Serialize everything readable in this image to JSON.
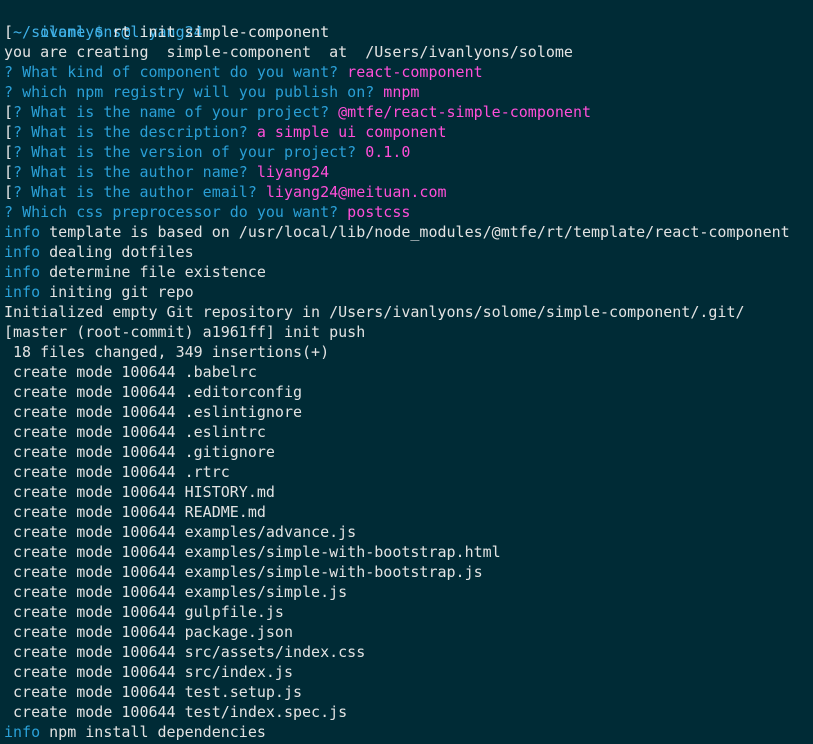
{
  "session": {
    "user_host": "ivanlyons@liyang24",
    "cwd": "~/solome",
    "prompt_symbol": "$",
    "command": "rt init simple-component"
  },
  "creating_line": "you are creating  simple-component  at  /Users/ivanlyons/solome",
  "questions": [
    {
      "prefix": "?",
      "question": "What kind of component do you want?",
      "answer": "react-component",
      "bracket": false
    },
    {
      "prefix": "?",
      "question": "which npm registry will you publish on?",
      "answer": "mnpm",
      "bracket": false
    },
    {
      "prefix": "?",
      "question": "What is the name of your project?",
      "answer": "@mtfe/react-simple-component",
      "bracket": true
    },
    {
      "prefix": "?",
      "question": "What is the description?",
      "answer": "a simple ui component",
      "bracket": true
    },
    {
      "prefix": "?",
      "question": "What is the version of your project?",
      "answer": "0.1.0",
      "bracket": true
    },
    {
      "prefix": "?",
      "question": "What is the author name?",
      "answer": "liyang24",
      "bracket": true
    },
    {
      "prefix": "?",
      "question": "What is the author email?",
      "answer": "liyang24@meituan.com",
      "bracket": true
    },
    {
      "prefix": "?",
      "question": "Which css preprocessor do you want?",
      "answer": "postcss",
      "bracket": false
    }
  ],
  "info_lines": [
    {
      "tag": "info",
      "text": "template is based on /usr/local/lib/node_modules/@mtfe/rt/template/react-component"
    },
    {
      "tag": "info",
      "text": "dealing dotfiles"
    },
    {
      "tag": "info",
      "text": "determine file existence"
    },
    {
      "tag": "info",
      "text": "initing git repo"
    }
  ],
  "git_output": [
    "Initialized empty Git repository in /Users/ivanlyons/solome/simple-component/.git/",
    "[master (root-commit) a1961ff] init push",
    " 18 files changed, 349 insertions(+)"
  ],
  "created_files": [
    " create mode 100644 .babelrc",
    " create mode 100644 .editorconfig",
    " create mode 100644 .eslintignore",
    " create mode 100644 .eslintrc",
    " create mode 100644 .gitignore",
    " create mode 100644 .rtrc",
    " create mode 100644 HISTORY.md",
    " create mode 100644 README.md",
    " create mode 100644 examples/advance.js",
    " create mode 100644 examples/simple-with-bootstrap.html",
    " create mode 100644 examples/simple-with-bootstrap.js",
    " create mode 100644 examples/simple.js",
    " create mode 100644 gulpfile.js",
    " create mode 100644 package.json",
    " create mode 100644 src/assets/index.css",
    " create mode 100644 src/index.js",
    " create mode 100644 test.setup.js",
    " create mode 100644 test/index.spec.js"
  ],
  "final_info": {
    "tag": "info",
    "text": "npm install dependencies"
  },
  "colors": {
    "background": "#002b36",
    "info_tag": "#2aa1d8",
    "answer": "#ff4fd8",
    "question": "#2a9fd6"
  }
}
